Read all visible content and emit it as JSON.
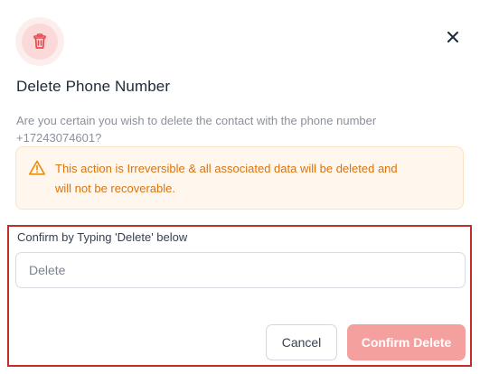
{
  "dialog": {
    "title": "Delete Phone Number",
    "description": "Are you certain you wish to delete the contact with the phone number +17243074601?",
    "header_icon": "trash-icon",
    "close_icon": "close-icon",
    "accent_color": "#e5484d"
  },
  "warning": {
    "icon": "warning-triangle-icon",
    "text": "This action is Irreversible & all associated data will be deleted and will not be recoverable.",
    "color": "#d9730d",
    "background": "#fff7ed"
  },
  "confirm": {
    "label": "Confirm by Typing 'Delete' below",
    "input_placeholder": "Delete",
    "input_value": "",
    "cancel_label": "Cancel",
    "confirm_label": "Confirm Delete",
    "confirm_color": "#f4a09f"
  }
}
